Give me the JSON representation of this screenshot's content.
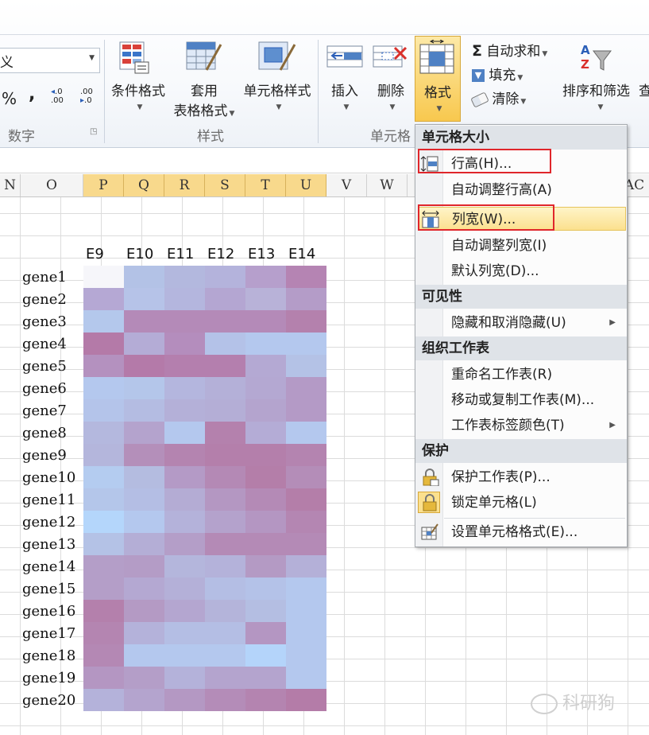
{
  "ribbon": {
    "number_format_value": "义",
    "number_symbols": {
      "percent": "%",
      "comma": ",",
      "inc_decimal": ".0\n.00",
      "dec_decimal": ".00\n.0"
    },
    "groups": {
      "number": "数字",
      "styles": "样式",
      "cells": "单元格"
    },
    "buttons": {
      "conditional_format": "条件格式",
      "table_format_1": "套用",
      "table_format_2": "表格格式",
      "cell_style": "单元格样式",
      "insert": "插入",
      "delete": "删除",
      "format": "格式",
      "autosum": "自动求和",
      "fill": "填充",
      "clear": "清除",
      "sort_filter": "排序和筛选",
      "find_cut": "查"
    },
    "icons": {
      "sigma": "Σ"
    }
  },
  "columns": [
    "N",
    "O",
    "P",
    "Q",
    "R",
    "S",
    "T",
    "U",
    "V",
    "W",
    "AC"
  ],
  "selected_columns": [
    "P",
    "Q",
    "R",
    "S",
    "T",
    "U"
  ],
  "sample_headers": [
    "E9",
    "E10",
    "E11",
    "E12",
    "E13",
    "E14"
  ],
  "genes": [
    "gene1",
    "gene2",
    "gene3",
    "gene4",
    "gene5",
    "gene6",
    "gene7",
    "gene8",
    "gene9",
    "gene10",
    "gene11",
    "gene12",
    "gene13",
    "gene14",
    "gene15",
    "gene16",
    "gene17",
    "gene18",
    "gene19",
    "gene20"
  ],
  "heatmap_colors": [
    [
      "#f6f6fa",
      "#b3c2e6",
      "#b3b8de",
      "#b4b3dc",
      "#b69fcc",
      "#b584b3"
    ],
    [
      "#b5a8d4",
      "#b6c3e8",
      "#b4b6de",
      "#b4a6d2",
      "#b8b2d8",
      "#b49cc8"
    ],
    [
      "#b4c8ec",
      "#b48ab8",
      "#b48ab8",
      "#b48ab8",
      "#b48ab8",
      "#b481ad"
    ],
    [
      "#b47aa8",
      "#b4acd6",
      "#b48dbd",
      "#b4c2e8",
      "#b4c8ee",
      "#b4c8ee"
    ],
    [
      "#b491bf",
      "#b47aa9",
      "#b47fae",
      "#b47fae",
      "#b4a9d3",
      "#b4c2e6"
    ],
    [
      "#b4c8ee",
      "#b4c6ea",
      "#b4b6de",
      "#b4b0d8",
      "#b4a8d2",
      "#b49ac6"
    ],
    [
      "#b4c4ea",
      "#b4bce2",
      "#b4b0d8",
      "#b4aed6",
      "#b4a4ce",
      "#b49ac6"
    ],
    [
      "#b4b8de",
      "#b4a3cd",
      "#b4c8ee",
      "#b481ad",
      "#b4acd6",
      "#b4c8ee"
    ],
    [
      "#b4b6dc",
      "#b48fba",
      "#b484b0",
      "#b47fab",
      "#b47fab",
      "#b484b0"
    ],
    [
      "#b4ccf0",
      "#b4bce0",
      "#b49ac6",
      "#b489b5",
      "#b47ea9",
      "#b48db8"
    ],
    [
      "#b4c6ea",
      "#b4bee4",
      "#b4acd4",
      "#b497c2",
      "#b48ab6",
      "#b47ea9"
    ],
    [
      "#b4d6fb",
      "#b4c8ee",
      "#b4b2da",
      "#b4a2cc",
      "#b496c2",
      "#b486b2"
    ],
    [
      "#b4c2e6",
      "#b4aed6",
      "#b49ec8",
      "#b48ab6",
      "#b48ab6",
      "#b48ab6"
    ],
    [
      "#b49ec8",
      "#b49cc6",
      "#b4b6dc",
      "#b4b2da",
      "#b49ac4",
      "#b4b0d8"
    ],
    [
      "#b49ec8",
      "#b4a8d2",
      "#b4b0d8",
      "#b4bee4",
      "#b4c2e8",
      "#b4c8ee"
    ],
    [
      "#b480ac",
      "#b49ac4",
      "#b4a6d0",
      "#b4b4da",
      "#b4bee2",
      "#b4c8ee"
    ],
    [
      "#b485b1",
      "#b4b2da",
      "#b4bee4",
      "#b4bee4",
      "#b496c2",
      "#b4c8ee"
    ],
    [
      "#b488b4",
      "#b4c8ee",
      "#b4c8ee",
      "#b4c8ee",
      "#b4d4fa",
      "#b4c8ee"
    ],
    [
      "#b496c2",
      "#b49ec8",
      "#b4b2da",
      "#b4a4ce",
      "#b4a4ce",
      "#b4c8ee"
    ],
    [
      "#b4b2da",
      "#b4a4ce",
      "#b498c3",
      "#b48cb8",
      "#b484b0",
      "#b47ca8"
    ]
  ],
  "menu": {
    "sections": {
      "cell_size": "单元格大小",
      "visibility": "可见性",
      "organize": "组织工作表",
      "protect": "保护"
    },
    "items": {
      "row_height": "行高(H)...",
      "autofit_row": "自动调整行高(A)",
      "col_width": "列宽(W)...",
      "autofit_col": "自动调整列宽(I)",
      "default_width": "默认列宽(D)...",
      "hide_unhide": "隐藏和取消隐藏(U)",
      "rename": "重命名工作表(R)",
      "move_copy": "移动或复制工作表(M)...",
      "tab_color": "工作表标签颜色(T)",
      "protect_sheet": "保护工作表(P)...",
      "lock_cell": "锁定单元格(L)",
      "format_cells": "设置单元格格式(E)..."
    },
    "colors": {
      "highlight": "#fbe08e",
      "red_box": "#e0262b"
    }
  },
  "watermark": "科研狗"
}
